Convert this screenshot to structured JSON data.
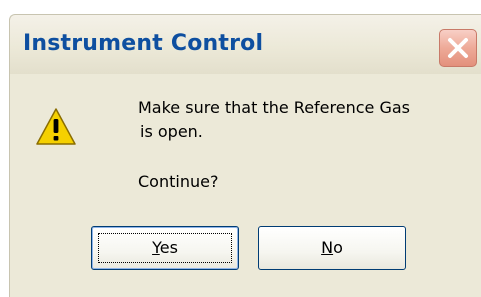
{
  "window": {
    "title": "Instrument Control",
    "close_icon": "close-icon"
  },
  "message": {
    "icon": "warning-icon",
    "line1": "Make sure that the Reference Gas",
    "line2": "is open.",
    "question": "Continue?"
  },
  "buttons": {
    "yes": {
      "accel": "Y",
      "rest": "es"
    },
    "no": {
      "accel": "N",
      "rest": "o"
    }
  },
  "colors": {
    "title_text": "#0e4fa0",
    "dialog_bg": "#ece9d8",
    "close_button": "#e3907c",
    "button_border": "#003c74",
    "warning_fill": "#f5d000"
  }
}
